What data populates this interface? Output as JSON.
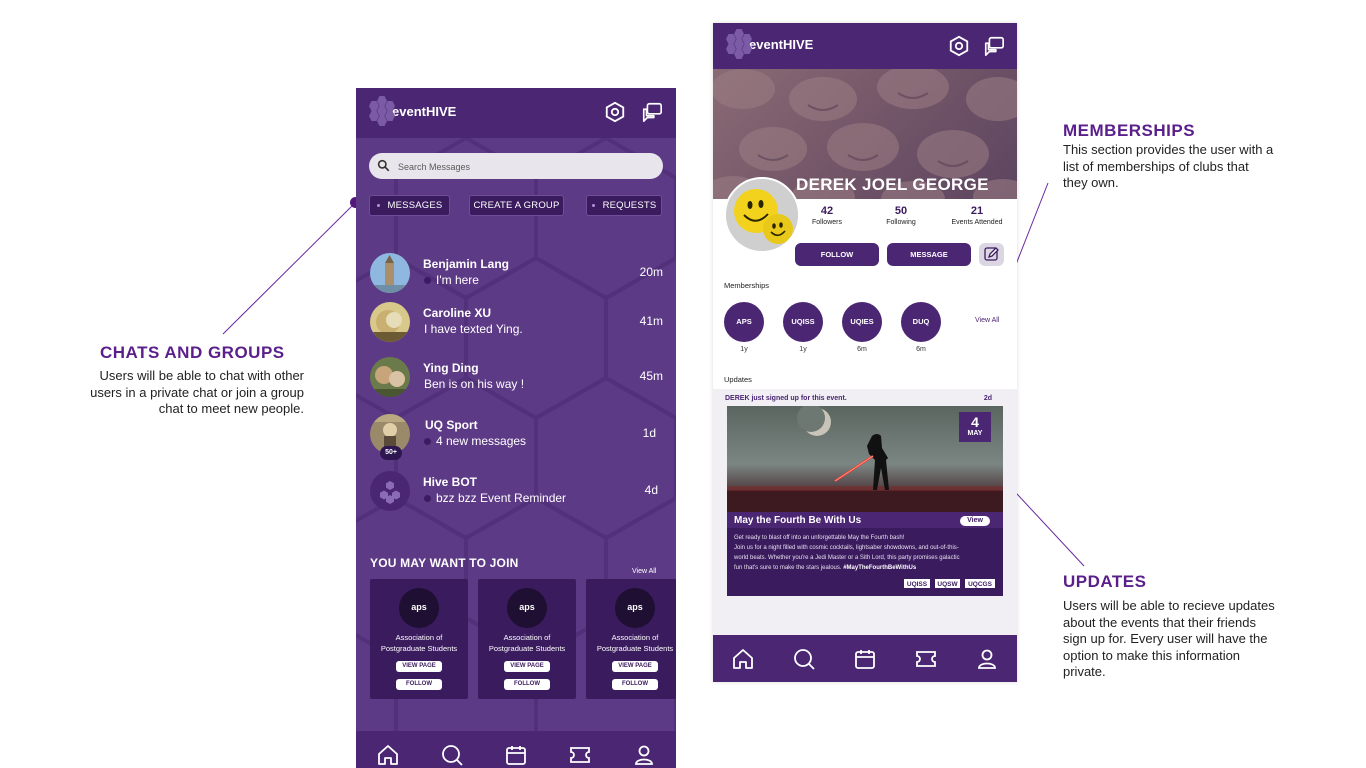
{
  "annotations": {
    "chats": {
      "title": "CHATS AND GROUPS",
      "lines": [
        "Users will be able to chat with other",
        "users in a private chat or join a group",
        "chat to meet new people."
      ]
    },
    "memberships": {
      "title": "MEMBERSHIPS",
      "lines": [
        "This section provides the user with a",
        "list of memberships of clubs that",
        "they own."
      ]
    },
    "updates": {
      "title": "UPDATES",
      "lines": [
        "Users will be able to recieve updates",
        "about the events that their friends",
        "sign up for. Every user will have the",
        "option to make this information",
        "private."
      ]
    }
  },
  "app": {
    "name": "eventHIVE"
  },
  "messages_screen": {
    "search_placeholder": "Search Messages",
    "tabs": [
      "MESSAGES",
      "CREATE A GROUP",
      "REQUESTS"
    ],
    "chats": [
      {
        "name": "Benjamin Lang",
        "message": "I'm here",
        "time": "20m",
        "unread_dot": true
      },
      {
        "name": "Caroline XU",
        "message": "I have texted Ying.",
        "time": "41m",
        "unread_dot": false
      },
      {
        "name": "Ying Ding",
        "message": "Ben is on his way !",
        "time": "45m",
        "unread_dot": false
      },
      {
        "name": "UQ Sport",
        "message": "4 new messages",
        "time": "1d",
        "unread_dot": true,
        "badge": "50+"
      },
      {
        "name": "Hive BOT",
        "message": "bzz bzz Event Reminder",
        "time": "4d",
        "unread_dot": true
      }
    ],
    "join_title": "YOU MAY WANT TO JOIN",
    "view_all": "View All",
    "groups": [
      {
        "logo": "aps",
        "name_line1": "Association of",
        "name_line2": "Postgraduate Students",
        "view_page": "VIEW PAGE",
        "follow": "FOLLOW"
      },
      {
        "logo": "aps",
        "name_line1": "Association of",
        "name_line2": "Postgraduate Students",
        "view_page": "VIEW PAGE",
        "follow": "FOLLOW"
      },
      {
        "logo": "aps",
        "name_line1": "Association of",
        "name_line2": "Postgraduate Students",
        "view_page": "VIEW PAGE",
        "follow": "FOLLOW"
      }
    ]
  },
  "profile_screen": {
    "name": "DEREK JOEL GEORGE",
    "stats": [
      {
        "value": "42",
        "label": "Followers"
      },
      {
        "value": "50",
        "label": "Following"
      },
      {
        "value": "21",
        "label": "Events Attended"
      }
    ],
    "follow": "FOLLOW",
    "message": "MESSAGE",
    "memberships_label": "Memberships",
    "memberships": [
      {
        "code": "APS",
        "age": "1y"
      },
      {
        "code": "UQISS",
        "age": "1y"
      },
      {
        "code": "UQIES",
        "age": "6m"
      },
      {
        "code": "DUQ",
        "age": "6m"
      }
    ],
    "view_all": "View All",
    "updates_label": "Updates",
    "update": {
      "headline": "DEREK just signed up for this event.",
      "time": "2d",
      "date_day": "4",
      "date_month": "MAY",
      "event_title": "May the Fourth Be With Us",
      "view": "View",
      "desc_1": "Get ready to blast off into an unforgettable May the Fourth bash!",
      "desc_2": "Join us for a night filled with cosmic cocktails, lightsaber showdowns, and out-of-this-",
      "desc_3": "world beats. Whether you're a Jedi Master or a Sith Lord, this party promises galactic",
      "desc_4": "fun that's sure to make the stars jealous.",
      "hashtag": "#MayTheFourthBeWithUs",
      "tags": [
        "UQISS",
        "UQSW",
        "UQCGS"
      ]
    }
  },
  "colors": {
    "primary": "#4a2673",
    "accent": "#5a1f8a",
    "panel": "#5d3a86"
  },
  "nav_icons": [
    "home-icon",
    "search-icon",
    "calendar-icon",
    "ticket-icon",
    "profile-icon"
  ]
}
